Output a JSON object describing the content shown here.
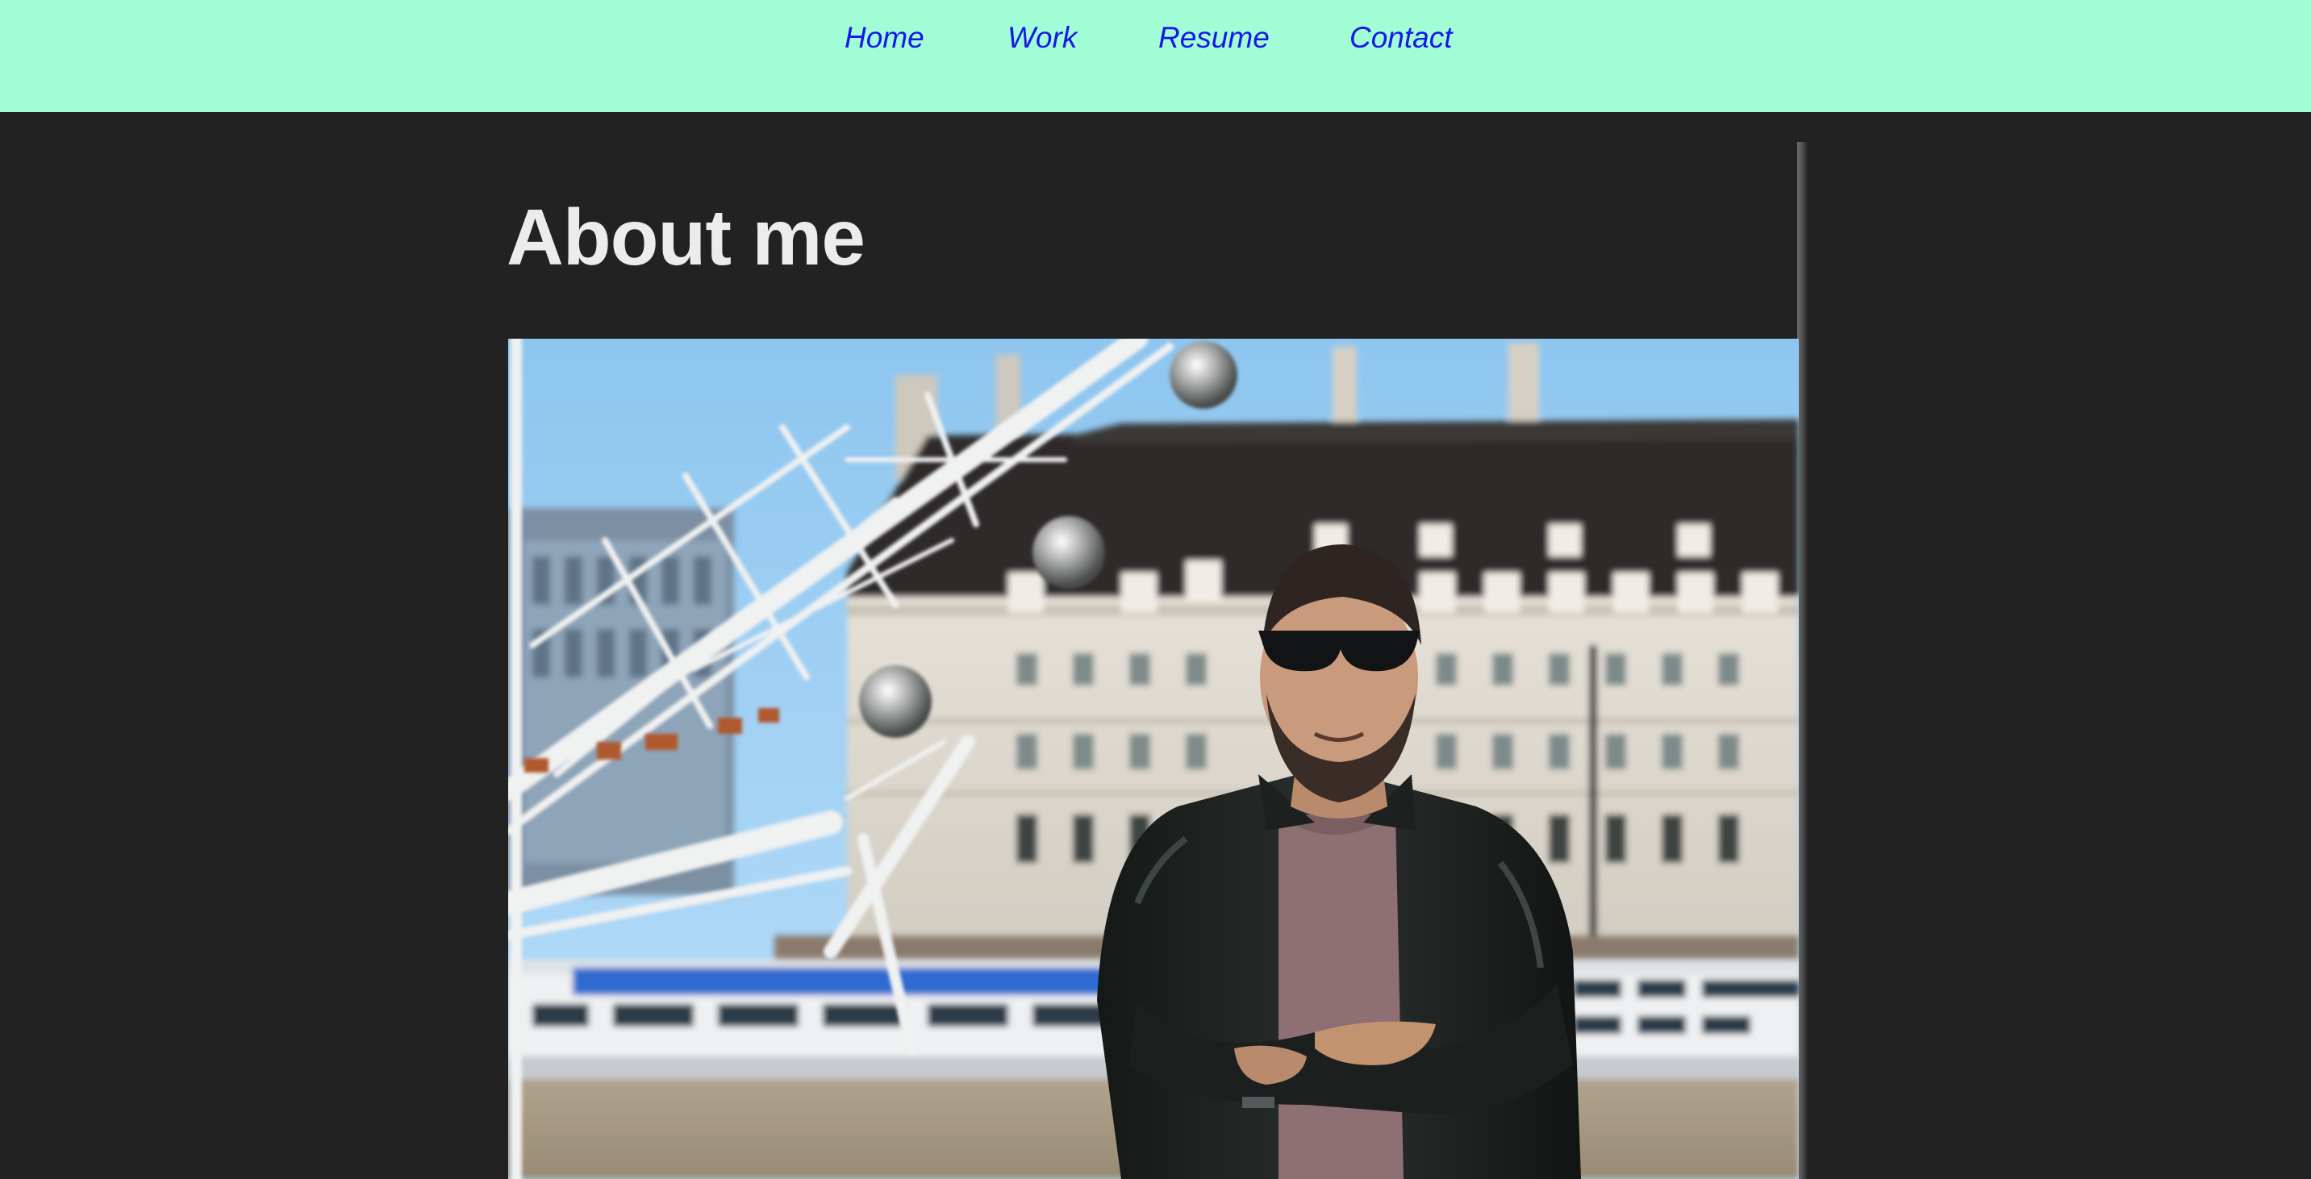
{
  "nav": {
    "items": [
      {
        "label": "Home"
      },
      {
        "label": "Work"
      },
      {
        "label": "Resume"
      },
      {
        "label": "Contact"
      }
    ]
  },
  "main": {
    "title": "About me"
  },
  "colors": {
    "nav_background": "#a1fdd6",
    "nav_link": "#1717e8",
    "page_background": "#222222",
    "title_text": "#ececec"
  }
}
